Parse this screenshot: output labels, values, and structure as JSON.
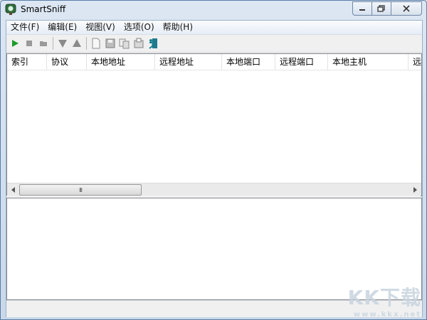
{
  "window": {
    "title": "SmartSniff"
  },
  "menu": [
    "文件(F)",
    "编辑(E)",
    "视图(V)",
    "选项(O)",
    "帮助(H)"
  ],
  "toolbar": [
    {
      "name": "start-capture-icon",
      "icon": "play"
    },
    {
      "name": "stop-capture-icon",
      "icon": "stop"
    },
    {
      "name": "capture-options-icon",
      "icon": "folder"
    },
    {
      "name": "scroll-down-icon",
      "icon": "triangle-down"
    },
    {
      "name": "scroll-up-icon",
      "icon": "triangle-up"
    },
    {
      "name": "new-icon",
      "icon": "page"
    },
    {
      "name": "save-icon",
      "icon": "disk"
    },
    {
      "name": "copy-icon",
      "icon": "copy"
    },
    {
      "name": "properties-icon",
      "icon": "properties"
    },
    {
      "name": "exit-icon",
      "icon": "exit"
    }
  ],
  "columns": [
    "索引",
    "协议",
    "本地地址",
    "远程地址",
    "本地端口",
    "远程端口",
    "本地主机",
    "远程"
  ],
  "scrollbar": {
    "grip": "III"
  },
  "watermark": {
    "brand": "KK下载",
    "url": "www.kkx.net"
  },
  "colors": {
    "accent": "#1c9b2a",
    "titlebar": "#dce7f3"
  }
}
